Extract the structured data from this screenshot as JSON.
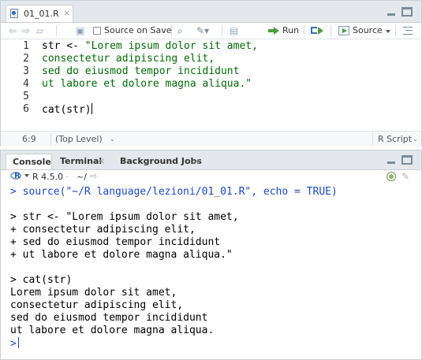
{
  "editor": {
    "tab_label": "01_01.R",
    "tab_close": "×",
    "toolbar": {
      "source_on_save_label": "Source on Save",
      "run_label": "Run",
      "source_label": "Source"
    },
    "line_numbers": [
      "1",
      "2",
      "3",
      "4",
      "5",
      "6"
    ],
    "code_lines": [
      {
        "prefix": "str <- ",
        "string": "\"Lorem ipsum dolor sit amet,"
      },
      {
        "prefix": "",
        "string": "consectetur adipiscing elit,"
      },
      {
        "prefix": "",
        "string": "sed do eiusmod tempor incididunt"
      },
      {
        "prefix": "",
        "string": "ut labore et dolore magna aliqua.\""
      },
      {
        "prefix": "",
        "string": ""
      },
      {
        "prefix": "cat(str)",
        "string": ""
      }
    ],
    "status": {
      "cursor_position": "6:9",
      "scope": "(Top Level)",
      "scope_caret": "⌄",
      "file_type": "R Script",
      "file_type_caret": "⌄"
    }
  },
  "console": {
    "tabs": [
      {
        "label": "Console",
        "close": ""
      },
      {
        "label": "Terminal",
        "close": "×"
      },
      {
        "label": "Background Jobs",
        "close": "×"
      }
    ],
    "r_version": "R 4.5.0",
    "separator": "·",
    "working_dir": "~/",
    "lines": [
      "> source(\"~/R language/lezioni/01_01.R\", echo = TRUE)",
      "",
      "> str <- \"Lorem ipsum dolor sit amet,",
      "+ consectetur adipiscing elit,",
      "+ sed do eiusmod tempor incididunt",
      "+ ut labore et dolore magna aliqua.\"",
      "",
      "> cat(str)",
      "Lorem ipsum dolor sit amet,",
      "consectetur adipiscing elit,",
      "sed do eiusmod tempor incididunt",
      "ut labore et dolore magna aliqua."
    ],
    "prompt": ">"
  },
  "colors": {
    "string": "#036a07",
    "console_command": "#1c4bc4",
    "run_green": "#4f9a3f"
  },
  "icons": [
    "r-file-icon",
    "back-icon",
    "forward-icon",
    "save-icon",
    "search-icon",
    "code-tools-icon",
    "compile-report-icon",
    "run-icon",
    "rerun-icon",
    "source-icon",
    "outline-icon",
    "minimize-icon",
    "maximize-icon",
    "r-logo-icon",
    "go-to-directory-icon",
    "environment-icon",
    "clear-console-icon"
  ]
}
